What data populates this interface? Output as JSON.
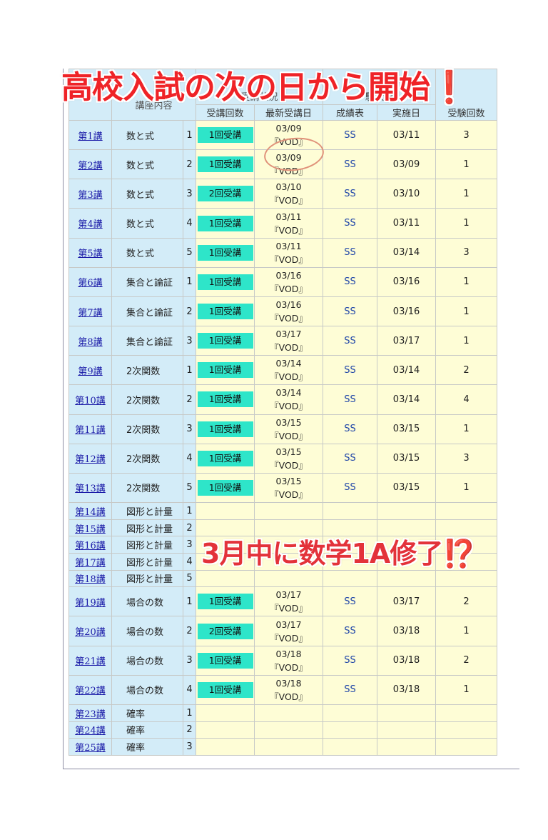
{
  "banner_top": "高校入試の次の日から開始❗️",
  "banner_mid": "3月中に数学1A修了⁉️",
  "header": {
    "course_col": "講座内容",
    "attend_group": "受講状況",
    "attend_count": "受講回数",
    "last_attend": "最新受講日",
    "exam_group": "験状況",
    "grades": "成績表",
    "exam_date": "実施日",
    "exam_count": "受験回数"
  },
  "rows": [
    {
      "lec": "第1講",
      "course": "数と式",
      "num": "1",
      "attend": "1回受講",
      "date": "03/09",
      "vod": "『VOD』",
      "ss": "SS",
      "exam_date": "03/11",
      "exam_count": "3"
    },
    {
      "lec": "第2講",
      "course": "数と式",
      "num": "2",
      "attend": "1回受講",
      "date": "03/09",
      "vod": "『VOD』",
      "ss": "SS",
      "exam_date": "03/09",
      "exam_count": "1"
    },
    {
      "lec": "第3講",
      "course": "数と式",
      "num": "3",
      "attend": "2回受講",
      "date": "03/10",
      "vod": "『VOD』",
      "ss": "SS",
      "exam_date": "03/10",
      "exam_count": "1"
    },
    {
      "lec": "第4講",
      "course": "数と式",
      "num": "4",
      "attend": "1回受講",
      "date": "03/11",
      "vod": "『VOD』",
      "ss": "SS",
      "exam_date": "03/11",
      "exam_count": "1"
    },
    {
      "lec": "第5講",
      "course": "数と式",
      "num": "5",
      "attend": "1回受講",
      "date": "03/11",
      "vod": "『VOD』",
      "ss": "SS",
      "exam_date": "03/14",
      "exam_count": "3"
    },
    {
      "lec": "第6講",
      "course": "集合と論証",
      "num": "1",
      "attend": "1回受講",
      "date": "03/16",
      "vod": "『VOD』",
      "ss": "SS",
      "exam_date": "03/16",
      "exam_count": "1"
    },
    {
      "lec": "第7講",
      "course": "集合と論証",
      "num": "2",
      "attend": "1回受講",
      "date": "03/16",
      "vod": "『VOD』",
      "ss": "SS",
      "exam_date": "03/16",
      "exam_count": "1"
    },
    {
      "lec": "第8講",
      "course": "集合と論証",
      "num": "3",
      "attend": "1回受講",
      "date": "03/17",
      "vod": "『VOD』",
      "ss": "SS",
      "exam_date": "03/17",
      "exam_count": "1"
    },
    {
      "lec": "第9講",
      "course": "2次関数",
      "num": "1",
      "attend": "1回受講",
      "date": "03/14",
      "vod": "『VOD』",
      "ss": "SS",
      "exam_date": "03/14",
      "exam_count": "2"
    },
    {
      "lec": "第10講",
      "course": "2次関数",
      "num": "2",
      "attend": "1回受講",
      "date": "03/14",
      "vod": "『VOD』",
      "ss": "SS",
      "exam_date": "03/14",
      "exam_count": "4"
    },
    {
      "lec": "第11講",
      "course": "2次関数",
      "num": "3",
      "attend": "1回受講",
      "date": "03/15",
      "vod": "『VOD』",
      "ss": "SS",
      "exam_date": "03/15",
      "exam_count": "1"
    },
    {
      "lec": "第12講",
      "course": "2次関数",
      "num": "4",
      "attend": "1回受講",
      "date": "03/15",
      "vod": "『VOD』",
      "ss": "SS",
      "exam_date": "03/15",
      "exam_count": "3"
    },
    {
      "lec": "第13講",
      "course": "2次関数",
      "num": "5",
      "attend": "1回受講",
      "date": "03/15",
      "vod": "『VOD』",
      "ss": "SS",
      "exam_date": "03/15",
      "exam_count": "1"
    },
    {
      "lec": "第14講",
      "course": "図形と計量",
      "num": "1"
    },
    {
      "lec": "第15講",
      "course": "図形と計量",
      "num": "2"
    },
    {
      "lec": "第16講",
      "course": "図形と計量",
      "num": "3"
    },
    {
      "lec": "第17講",
      "course": "図形と計量",
      "num": "4"
    },
    {
      "lec": "第18講",
      "course": "図形と計量",
      "num": "5"
    },
    {
      "lec": "第19講",
      "course": "場合の数",
      "num": "1",
      "attend": "1回受講",
      "date": "03/17",
      "vod": "『VOD』",
      "ss": "SS",
      "exam_date": "03/17",
      "exam_count": "2"
    },
    {
      "lec": "第20講",
      "course": "場合の数",
      "num": "2",
      "attend": "2回受講",
      "date": "03/17",
      "vod": "『VOD』",
      "ss": "SS",
      "exam_date": "03/18",
      "exam_count": "1"
    },
    {
      "lec": "第21講",
      "course": "場合の数",
      "num": "3",
      "attend": "1回受講",
      "date": "03/18",
      "vod": "『VOD』",
      "ss": "SS",
      "exam_date": "03/18",
      "exam_count": "2"
    },
    {
      "lec": "第22講",
      "course": "場合の数",
      "num": "4",
      "attend": "1回受講",
      "date": "03/18",
      "vod": "『VOD』",
      "ss": "SS",
      "exam_date": "03/18",
      "exam_count": "1"
    },
    {
      "lec": "第23講",
      "course": "確率",
      "num": "1"
    },
    {
      "lec": "第24講",
      "course": "確率",
      "num": "2"
    },
    {
      "lec": "第25講",
      "course": "確率",
      "num": "3"
    }
  ],
  "colors": {
    "header_bg": "#d3ecf8",
    "cell_bg": "#fefdd6",
    "pill": "#2ee5c9",
    "accent_red": "#ef2327"
  }
}
